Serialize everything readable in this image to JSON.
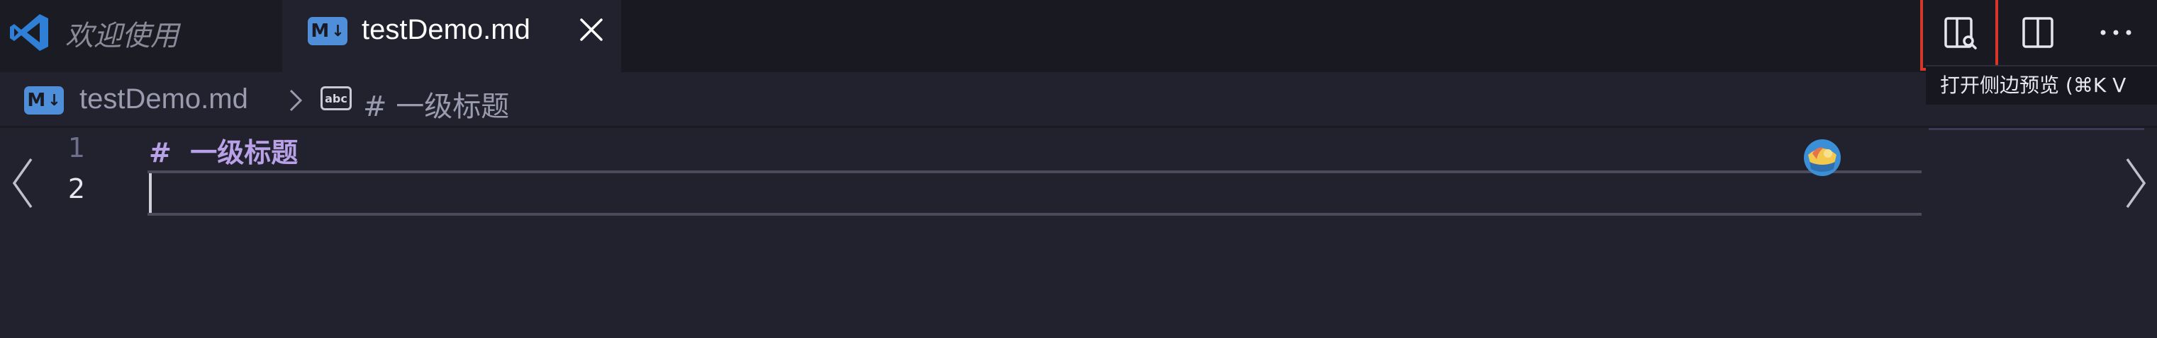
{
  "tabs": [
    {
      "label": "欢迎使用",
      "active": false
    },
    {
      "label": "testDemo.md",
      "active": true
    }
  ],
  "tab_close_label": "×",
  "md_badge": {
    "letters": "M",
    "arrow": "↓"
  },
  "toolbar": {
    "preview_side_tooltip": "打开侧边预览 (⌘K V"
  },
  "breadcrumb": {
    "file": "testDemo.md",
    "symbol_icon_text": "abc",
    "heading": "# 一级标题"
  },
  "editor": {
    "line_numbers": [
      "1",
      "2"
    ],
    "lines": [
      "#  一级标题",
      ""
    ]
  },
  "colors": {
    "tab_bar_bg": "#191922",
    "editor_bg": "#22222e",
    "md_badge": "#4f8ed8",
    "heading_text": "#b9a1e8",
    "highlight_border": "#d7372a"
  },
  "icons": {
    "app": "vscode-icon",
    "file": "markdown-icon",
    "preview_side": "open-preview-side-icon",
    "split": "split-editor-icon",
    "more": "more-actions-icon",
    "symbol": "string-symbol-icon"
  }
}
